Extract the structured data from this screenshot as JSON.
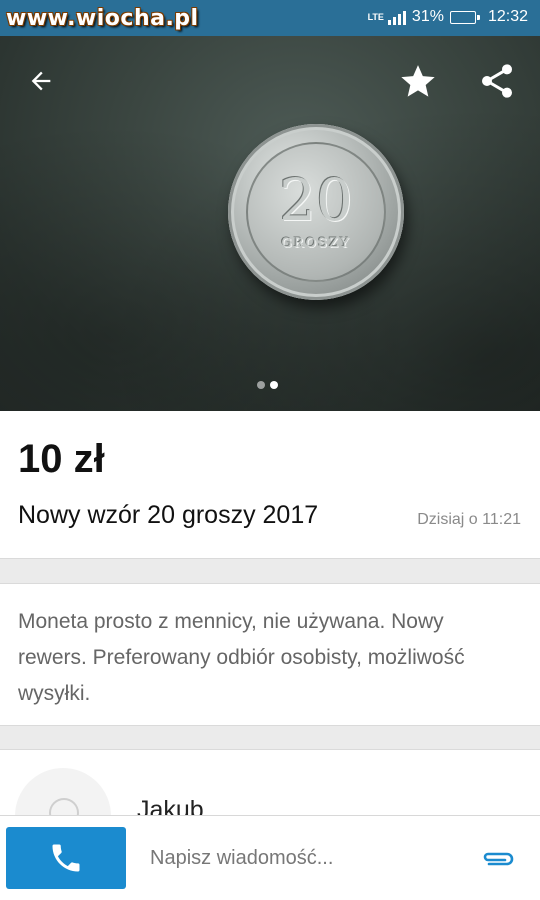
{
  "status_bar": {
    "watermark": "www.wiocha.pl",
    "network": "LTE",
    "battery_level": 0.31,
    "battery_label": "31%",
    "time": "12:32"
  },
  "gallery": {
    "coin_value": "20",
    "coin_text": "GROSZY",
    "total_images": 2,
    "active_image": 2
  },
  "listing": {
    "price": "10 zł",
    "title": "Nowy wzór 20 groszy 2017",
    "posted": "Dzisiaj o 11:21",
    "description": "Moneta prosto z mennicy, nie używana. Nowy rewers. Preferowany odbiór osobisty, możliwość wysyłki."
  },
  "seller": {
    "name": "Jakub"
  },
  "bottom_bar": {
    "message_placeholder": "Napisz wiadomość..."
  },
  "colors": {
    "status_bar": "#2a6f97",
    "accent": "#1b8bcf"
  },
  "icons": {
    "back": "arrow-left-icon",
    "favorite": "star-icon",
    "share": "share-icon",
    "call": "phone-icon",
    "attach": "paperclip-icon"
  }
}
